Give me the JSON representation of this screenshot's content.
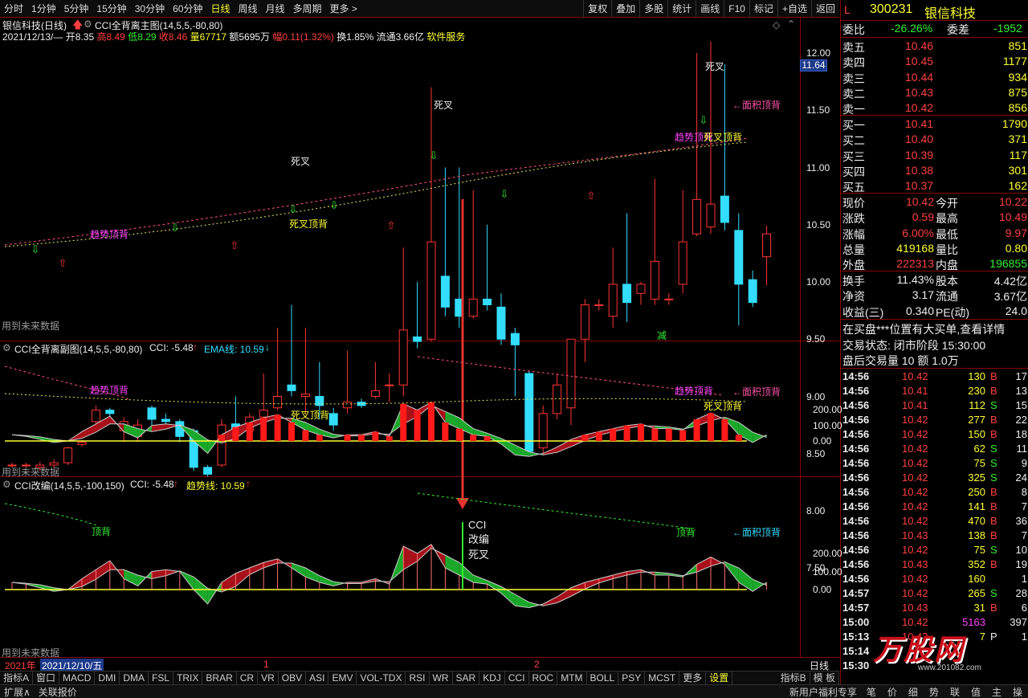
{
  "toolbar": {
    "periods": [
      "分时",
      "1分钟",
      "5分钟",
      "15分钟",
      "30分钟",
      "60分钟",
      "日线",
      "周线",
      "月线",
      "多周期",
      "更多 >"
    ],
    "active_period": "日线",
    "buttons": [
      "复权",
      "叠加",
      "多股",
      "统计",
      "画线",
      "F10",
      "标记",
      "+自选",
      "返回"
    ]
  },
  "main_chart": {
    "header_name": "银信科技(日线)",
    "header_indicator": "CCI全背离主图(14,5,5,-80,80)",
    "info_date": "2021/12/13/—",
    "info_open_label": "开",
    "info_open": "8.35",
    "info_high_label": "高",
    "info_high": "8.49",
    "info_low_label": "低",
    "info_low": "8.29",
    "info_close_label": "收",
    "info_close": "8.46",
    "info_vol_label": "量",
    "info_vol": "67717",
    "info_amount": "额5695万",
    "info_amp_label": "幅",
    "info_amp": "0.11(1.32%)",
    "info_turnover": "换1.85%",
    "info_float": "流通3.66亿",
    "info_sector": "软件服务",
    "future_note": "用到未来数据",
    "price_ticks": [
      "12.00",
      "11.50",
      "11.00",
      "10.50",
      "10.00",
      "9.50",
      "9.00",
      "8.50",
      "8.00",
      "7.50"
    ],
    "current_price_tag": "11.64",
    "labels": {
      "death_cross_1": "死叉",
      "death_cross_2": "死叉",
      "death_cross_3": "死叉",
      "area_top_div": "←面积顶背",
      "trend_top_div_1": "趋势顶背",
      "trend_top_div_2": "趋势顶背",
      "dead_top_div_1": "死叉顶背",
      "dead_top_div_2": "死叉顶背",
      "reduce": "减"
    }
  },
  "sub1": {
    "title": "CCI全背离副图(14,5,5,-80,80)",
    "cci_label": "CCI: -5.48",
    "ema_label": "EMA线: 10.59",
    "ticks": [
      "200.00",
      "100.00",
      "0.00"
    ],
    "labels": {
      "trend_top_div_1": "趋势顶背",
      "trend_top_div_2": "趋势顶背",
      "dead_top_div_1": "死叉顶背",
      "dead_top_div_2": "死叉顶背",
      "area_top_div": "←面积顶背"
    },
    "future_note": "用到未来数据"
  },
  "sub2": {
    "title": "CCI改编(14,5,5,-100,150)",
    "cci_label": "CCI: -5.48",
    "trend_label": "趋势线: 10.59",
    "ticks": [
      "200.00",
      "100.00",
      "0.00"
    ],
    "labels": {
      "top_div_1": "顶背",
      "top_div_2": "顶背",
      "area_top_div": "←面积顶背",
      "cci_line1": "CCI",
      "cci_line2": "改编",
      "cci_line3": "死叉"
    },
    "future_note": "用到未来数据"
  },
  "xaxis": {
    "year": "2021年",
    "date_highlight": "2021/12/10/五",
    "month1": "1",
    "month2": "2",
    "period_btn": "日线"
  },
  "indicator_tabs": [
    "指标A",
    "窗口",
    "MACD",
    "DMI",
    "DMA",
    "FSL",
    "TRIX",
    "BRAR",
    "CR",
    "VR",
    "OBV",
    "ASI",
    "EMV",
    "VOL-TDX",
    "RSI",
    "WR",
    "SAR",
    "KDJ",
    "CCI",
    "ROC",
    "MTM",
    "BOLL",
    "PSY",
    "MCST",
    "更多",
    "设置"
  ],
  "indicator_right": [
    "指标B",
    "模 板"
  ],
  "status": {
    "expand": "扩展∧",
    "related": "关联报价",
    "right_text": "新用户福利专享",
    "icons": [
      "笔",
      "价",
      "细",
      "势",
      "联",
      "值",
      "主",
      "操"
    ]
  },
  "quote": {
    "marker": "L",
    "code": "300231",
    "name": "银信科技",
    "webi_label": "委比",
    "webi_value": "-26.26%",
    "weicha_label": "委差",
    "weicha_value": "-1952",
    "sell": [
      {
        "label": "卖五",
        "price": "10.46",
        "vol": "851"
      },
      {
        "label": "卖四",
        "price": "10.45",
        "vol": "1177"
      },
      {
        "label": "卖三",
        "price": "10.44",
        "vol": "934"
      },
      {
        "label": "卖二",
        "price": "10.43",
        "vol": "875"
      },
      {
        "label": "卖一",
        "price": "10.42",
        "vol": "856"
      }
    ],
    "buy": [
      {
        "label": "买一",
        "price": "10.41",
        "vol": "1790"
      },
      {
        "label": "买二",
        "price": "10.40",
        "vol": "371"
      },
      {
        "label": "买三",
        "price": "10.39",
        "vol": "117"
      },
      {
        "label": "买四",
        "price": "10.38",
        "vol": "301"
      },
      {
        "label": "买五",
        "price": "10.37",
        "vol": "162"
      }
    ],
    "stats": [
      {
        "l1": "现价",
        "v1": "10.42",
        "l2": "今开",
        "v2": "10.22"
      },
      {
        "l1": "涨跌",
        "v1": "0.59",
        "l2": "最高",
        "v2": "10.49"
      },
      {
        "l1": "涨幅",
        "v1": "6.00%",
        "l2": "最低",
        "v2": "9.97"
      },
      {
        "l1": "总量",
        "v1": "419168",
        "l2": "量比",
        "v2": "0.80"
      },
      {
        "l1": "外盘",
        "v1": "222313",
        "l2": "内盘",
        "v2": "196855"
      }
    ],
    "stats2": [
      {
        "l1": "换手",
        "v1": "11.43%",
        "l2": "股本",
        "v2": "4.42亿"
      },
      {
        "l1": "净资",
        "v1": "3.17",
        "l2": "流通",
        "v2": "3.67亿"
      },
      {
        "l1": "收益(三)",
        "v1": "0.340",
        "l2": "PE(动)",
        "v2": "24.0"
      }
    ],
    "notice": "在买盘***位置有大买单,查看详情",
    "trade_state": "交易状态: 闭市阶段 15:30:00",
    "after_hours": "盘后交易量 10 额 1.0万",
    "ticks": [
      {
        "t": "14:56",
        "p": "10.42",
        "v": "130",
        "d": "B",
        "n": "17"
      },
      {
        "t": "14:56",
        "p": "10.41",
        "v": "230",
        "d": "B",
        "n": "13"
      },
      {
        "t": "14:56",
        "p": "10.41",
        "v": "112",
        "d": "S",
        "n": "15"
      },
      {
        "t": "14:56",
        "p": "10.42",
        "v": "277",
        "d": "B",
        "n": "22"
      },
      {
        "t": "14:56",
        "p": "10.42",
        "v": "150",
        "d": "B",
        "n": "18"
      },
      {
        "t": "14:56",
        "p": "10.42",
        "v": "62",
        "d": "S",
        "n": "11"
      },
      {
        "t": "14:56",
        "p": "10.42",
        "v": "75",
        "d": "S",
        "n": "9"
      },
      {
        "t": "14:56",
        "p": "10.42",
        "v": "325",
        "d": "S",
        "n": "24"
      },
      {
        "t": "14:56",
        "p": "10.42",
        "v": "250",
        "d": "B",
        "n": "8"
      },
      {
        "t": "14:56",
        "p": "10.42",
        "v": "141",
        "d": "B",
        "n": "7"
      },
      {
        "t": "14:56",
        "p": "10.42",
        "v": "470",
        "d": "B",
        "n": "36"
      },
      {
        "t": "14:56",
        "p": "10.43",
        "v": "138",
        "d": "B",
        "n": "7"
      },
      {
        "t": "14:56",
        "p": "10.42",
        "v": "75",
        "d": "S",
        "n": "10"
      },
      {
        "t": "14:56",
        "p": "10.43",
        "v": "352",
        "d": "B",
        "n": "19"
      },
      {
        "t": "14:56",
        "p": "10.42",
        "v": "160",
        "d": "",
        "n": "1"
      },
      {
        "t": "14:57",
        "p": "10.42",
        "v": "265",
        "d": "S",
        "n": "28"
      },
      {
        "t": "14:57",
        "p": "10.43",
        "v": "31",
        "d": "B",
        "n": "6"
      },
      {
        "t": "15:00",
        "p": "10.42",
        "v": "5163",
        "d": "",
        "n": "397"
      },
      {
        "t": "15:13",
        "p": "10.42",
        "v": "7",
        "d": "P",
        "n": "1"
      },
      {
        "t": "15:14",
        "p": "",
        "v": "",
        "d": "",
        "n": ""
      },
      {
        "t": "15:30",
        "p": "",
        "v": "",
        "d": "",
        "n": ""
      }
    ],
    "watermark": "万股网",
    "watermark_url": "www.201082.com"
  }
}
